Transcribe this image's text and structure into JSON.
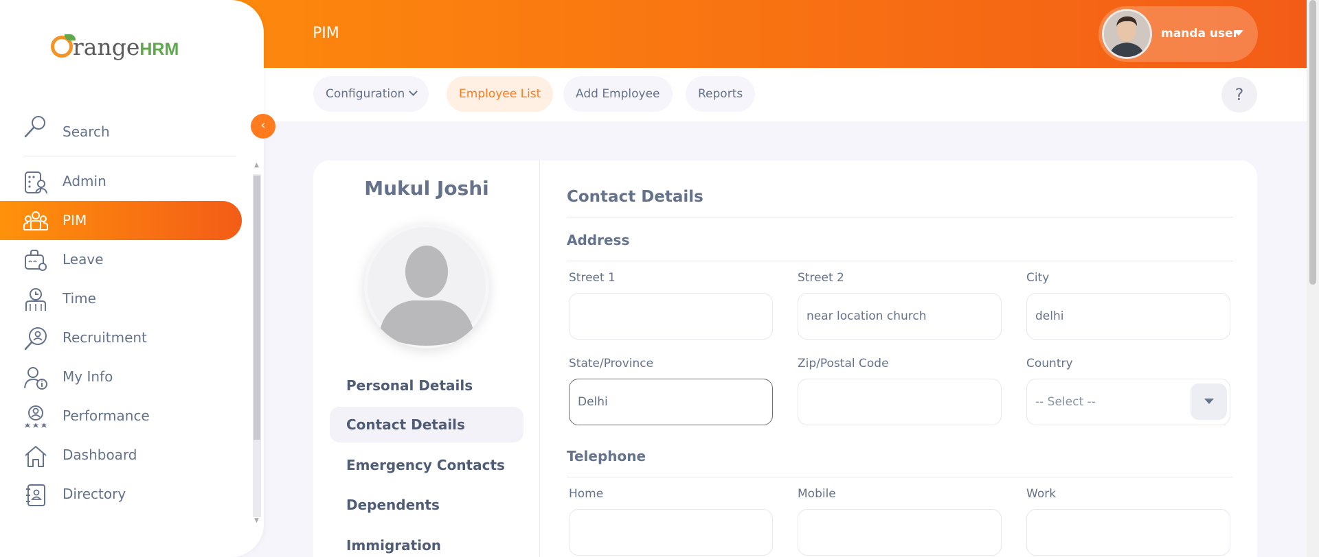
{
  "app": {
    "logo_text": "OrangeHRM",
    "module_title": "PIM"
  },
  "user": {
    "name": "manda user"
  },
  "topnav": {
    "items": [
      {
        "label": "Configuration",
        "has_dropdown": true
      },
      {
        "label": "Employee List",
        "active": true
      },
      {
        "label": "Add Employee"
      },
      {
        "label": "Reports"
      }
    ],
    "help_label": "?"
  },
  "sidebar": {
    "search_label": "Search",
    "items": [
      {
        "label": "Admin",
        "icon": "admin-icon"
      },
      {
        "label": "PIM",
        "icon": "pim-icon",
        "active": true
      },
      {
        "label": "Leave",
        "icon": "leave-icon"
      },
      {
        "label": "Time",
        "icon": "time-icon"
      },
      {
        "label": "Recruitment",
        "icon": "recruitment-icon"
      },
      {
        "label": "My Info",
        "icon": "my-info-icon"
      },
      {
        "label": "Performance",
        "icon": "performance-icon"
      },
      {
        "label": "Dashboard",
        "icon": "dashboard-icon"
      },
      {
        "label": "Directory",
        "icon": "directory-icon"
      }
    ]
  },
  "employee": {
    "name": "Mukul Joshi",
    "tabs": [
      {
        "label": "Personal Details"
      },
      {
        "label": "Contact Details",
        "active": true
      },
      {
        "label": "Emergency Contacts"
      },
      {
        "label": "Dependents"
      },
      {
        "label": "Immigration"
      }
    ]
  },
  "form": {
    "title": "Contact Details",
    "address": {
      "title": "Address",
      "street1": {
        "label": "Street 1",
        "value": ""
      },
      "street2": {
        "label": "Street 2",
        "value": "near location church"
      },
      "city": {
        "label": "City",
        "value": "delhi"
      },
      "state": {
        "label": "State/Province",
        "value": "Delhi"
      },
      "zip": {
        "label": "Zip/Postal Code",
        "value": ""
      },
      "country": {
        "label": "Country",
        "value": "-- Select --"
      }
    },
    "telephone": {
      "title": "Telephone",
      "home": {
        "label": "Home",
        "value": ""
      },
      "mobile": {
        "label": "Mobile",
        "value": ""
      },
      "work": {
        "label": "Work",
        "value": ""
      }
    }
  },
  "colors": {
    "brand_orange": "#ff7b1d",
    "brand_green": "#5fa84b",
    "text": "#64728c"
  }
}
